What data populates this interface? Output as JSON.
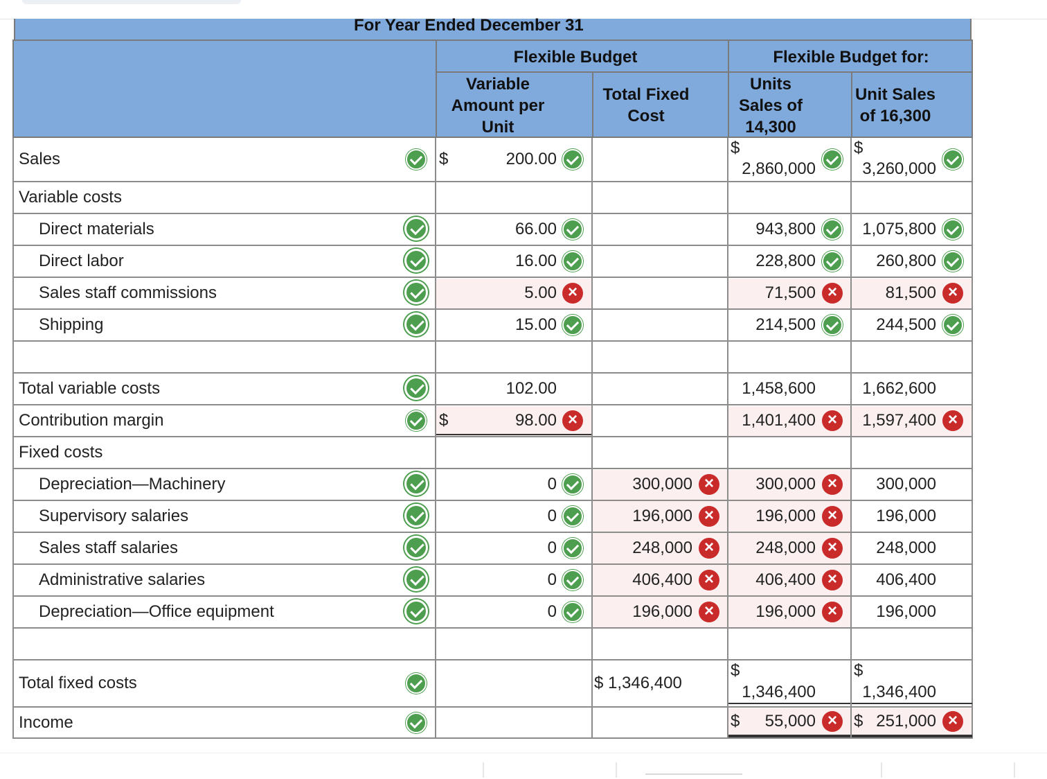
{
  "header": {
    "caption": "For Year Ended December 31",
    "flexible_budget": "Flexible Budget",
    "flexible_budget_for": "Flexible Budget for:",
    "variable_amount": "Variable Amount per Unit",
    "total_fixed_cost": "Total Fixed Cost",
    "units_sales_1": "Units Sales of 14,300",
    "units_sales_2": "Unit Sales of 16,300"
  },
  "rows": {
    "sales": {
      "label": "Sales",
      "var_sign": "$",
      "var": "200.00",
      "f1_sign": "$",
      "f1": "2,860,000",
      "f2_sign": "$",
      "f2": "3,260,000"
    },
    "variable_costs": {
      "label": "Variable costs"
    },
    "direct_materials": {
      "label": "Direct materials",
      "var": "66.00",
      "f1": "943,800",
      "f2": "1,075,800"
    },
    "direct_labor": {
      "label": "Direct labor",
      "var": "16.00",
      "f1": "228,800",
      "f2": "260,800"
    },
    "sales_commissions": {
      "label": "Sales staff commissions",
      "var": "5.00",
      "f1": "71,500",
      "f2": "81,500"
    },
    "shipping": {
      "label": "Shipping",
      "var": "15.00",
      "f1": "214,500",
      "f2": "244,500"
    },
    "total_variable": {
      "label": "Total variable costs",
      "var": "102.00",
      "f1": "1,458,600",
      "f2": "1,662,600"
    },
    "contribution": {
      "label": "Contribution margin",
      "var_sign": "$",
      "var": "98.00",
      "f1": "1,401,400",
      "f2": "1,597,400"
    },
    "fixed_costs": {
      "label": "Fixed costs"
    },
    "dep_machinery": {
      "label": "Depreciation—Machinery",
      "var": "0",
      "fixed": "300,000",
      "f1": "300,000",
      "f2": "300,000"
    },
    "supervisory": {
      "label": "Supervisory salaries",
      "var": "0",
      "fixed": "196,000",
      "f1": "196,000",
      "f2": "196,000"
    },
    "sales_salaries": {
      "label": "Sales staff salaries",
      "var": "0",
      "fixed": "248,000",
      "f1": "248,000",
      "f2": "248,000"
    },
    "admin_salaries": {
      "label": "Administrative salaries",
      "var": "0",
      "fixed": "406,400",
      "f1": "406,400",
      "f2": "406,400"
    },
    "dep_office": {
      "label": "Depreciation—Office equipment",
      "var": "0",
      "fixed": "196,000",
      "f1": "196,000",
      "f2": "196,000"
    },
    "total_fixed": {
      "label": "Total fixed costs",
      "fixed": "$ 1,346,400",
      "f1_sign": "$",
      "f1": "1,346,400",
      "f2_sign": "$",
      "f2": "1,346,400"
    },
    "income": {
      "label": "Income",
      "f1_sign": "$",
      "f1": "55,000",
      "f2_sign": "$",
      "f2": "251,000"
    }
  },
  "colors": {
    "header_bg": "#80aadc",
    "correct": "#4d9e4f",
    "incorrect": "#c92a2a",
    "incorrect_cell_bg": "#fbefef"
  },
  "icons": {
    "correct": "check-circle-icon",
    "incorrect": "x-circle-icon"
  }
}
